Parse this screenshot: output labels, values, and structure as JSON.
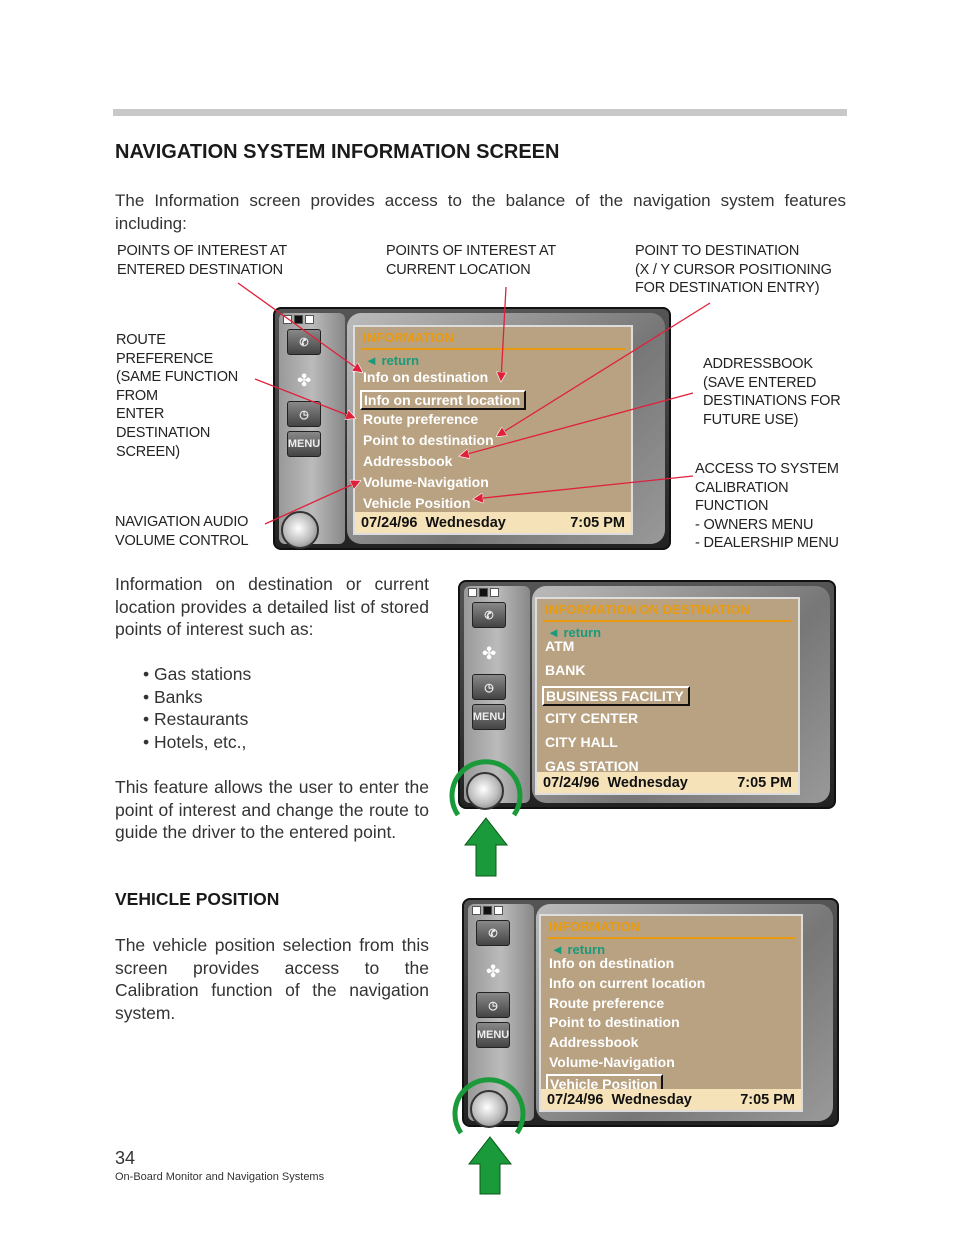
{
  "page": {
    "title": "NAVIGATION SYSTEM INFORMATION SCREEN",
    "intro": "The Information screen provides access to the balance of the navigation system features including:",
    "callouts": {
      "poi_destination": [
        "POINTS OF INTEREST AT",
        "ENTERED DESTINATION"
      ],
      "poi_current": [
        "POINTS OF INTEREST AT",
        "CURRENT LOCATION"
      ],
      "point_to_destination": [
        "POINT TO DESTINATION",
        "(X / Y CURSOR POSITIONING",
        "FOR DESTINATION ENTRY)"
      ],
      "route_preference": [
        "ROUTE",
        "PREFERENCE",
        "(SAME FUNCTION",
        "FROM",
        "ENTER",
        "DESTINATION",
        "SCREEN)"
      ],
      "addressbook": [
        "ADDRESSBOOK",
        "(SAVE ENTERED",
        "DESTINATIONS FOR",
        "FUTURE USE)"
      ],
      "calibration": [
        "ACCESS TO SYSTEM",
        "CALIBRATION",
        "FUNCTION",
        "- OWNERS MENU",
        "- DEALERSHIP MENU"
      ],
      "volume": [
        "NAVIGATION AUDIO",
        "VOLUME CONTROL"
      ]
    },
    "info_paragraph": "Information on destination or current location provides a detailed list of stored points of interest such as:",
    "bullets": [
      "• Gas stations",
      "• Banks",
      "• Restaurants",
      "• Hotels, etc.,"
    ],
    "feature_paragraph": "This feature allows the user to enter the point of interest and change the route to guide the driver to the entered point.",
    "vehicle_heading": "VEHICLE POSITION",
    "vehicle_paragraph": "The vehicle position selection from this screen provides access to the Calibration function of the navigation system.",
    "page_number": "34",
    "footer": "On-Board Monitor and Navigation Systems"
  },
  "monitor_buttons": {
    "menu": "MENU",
    "icons": [
      "phone-icon",
      "fan-icon",
      "clock-icon"
    ]
  },
  "screens": [
    {
      "title": "INFORMATION",
      "return": "return",
      "items": [
        "Info on destination",
        "Info on current location",
        "Route preference",
        "Point to destination",
        "Addressbook",
        "Volume-Navigation",
        "Vehicle Position"
      ],
      "selected": 1,
      "date": "07/24/96  Wednesday",
      "time": "7:05 PM"
    },
    {
      "title": "INFORMATION ON DESTINATION",
      "return": "return",
      "items": [
        "ATM",
        "BANK",
        "BUSINESS FACILITY",
        "CITY CENTER",
        "CITY HALL",
        "GAS STATION"
      ],
      "selected": 2,
      "date": "07/24/96  Wednesday",
      "time": "7:05 PM"
    },
    {
      "title": "INFORMATION",
      "return": "return",
      "items": [
        "Info on destination",
        "Info on current location",
        "Route preference",
        "Point to destination",
        "Addressbook",
        "Volume-Navigation",
        "Vehicle Position"
      ],
      "selected": 6,
      "date": "07/24/96  Wednesday",
      "time": "7:05 PM"
    }
  ],
  "colors": {
    "screen_bg": "#b8a282",
    "title": "#e89a10",
    "return": "#1a9a7a",
    "arrow_red": "#e0203a",
    "rotate_green": "#1a9a3a"
  }
}
